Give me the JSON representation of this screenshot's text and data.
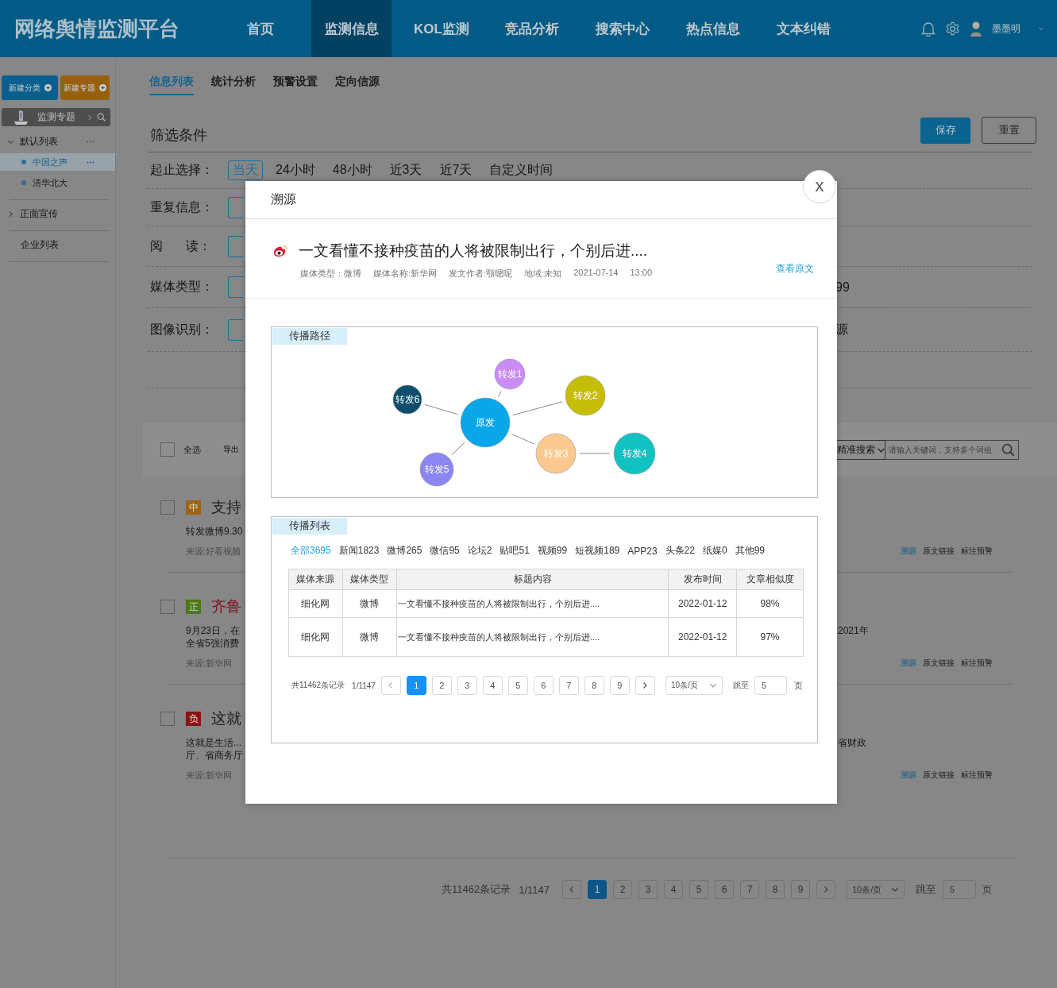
{
  "header": {
    "logo": "网络舆情监测平台",
    "nav": [
      {
        "label": "首页",
        "selected": false
      },
      {
        "label": "监测信息",
        "selected": true
      },
      {
        "label": "KOL监测",
        "selected": false
      },
      {
        "label": "竞品分析",
        "selected": false
      },
      {
        "label": "搜索中心",
        "selected": false
      },
      {
        "label": "热点信息",
        "selected": false
      },
      {
        "label": "文本纠错",
        "selected": false
      }
    ],
    "user": "墨墨明"
  },
  "sidebar": {
    "buttons": [
      {
        "label": "新建分类",
        "kind": "primary"
      },
      {
        "label": "新建专题",
        "kind": "warning"
      }
    ],
    "panel_title": "监测专题",
    "tree": [
      {
        "label": "默认列表",
        "kind": "folder",
        "expanded": true,
        "children": [
          {
            "label": "中国之声",
            "selected": true
          },
          {
            "label": "清华北大",
            "selected": false
          }
        ]
      },
      {
        "label": "正面宣传",
        "kind": "folder",
        "expanded": false
      },
      {
        "label": "企业列表",
        "kind": "item"
      }
    ]
  },
  "tabs": [
    {
      "label": "信息列表",
      "selected": true
    },
    {
      "label": "统计分析",
      "selected": false
    },
    {
      "label": "预警设置",
      "selected": false
    },
    {
      "label": "定向信源",
      "selected": false
    }
  ],
  "filter": {
    "title": "筛选条件",
    "buttons": [
      {
        "label": "保存",
        "kind": "primary"
      },
      {
        "label": "重置",
        "kind": "default"
      }
    ],
    "rows": [
      {
        "label": "起止选择：",
        "kind": "options",
        "options": [
          {
            "label": "当天",
            "selected": true
          },
          {
            "label": "24小时",
            "selected": false
          },
          {
            "label": "48小时",
            "selected": false
          },
          {
            "label": "近3天",
            "selected": false
          },
          {
            "label": "近7天",
            "selected": false
          },
          {
            "label": "自定义时间",
            "selected": false
          }
        ]
      },
      {
        "label": "重复信息：",
        "kind": "covered"
      },
      {
        "label": "阅 读：",
        "kind": "covered"
      },
      {
        "label": "媒体类型：",
        "kind": "covered",
        "tail": "99"
      },
      {
        "label": "图像识别：",
        "kind": "covered",
        "tail": "源"
      }
    ]
  },
  "toolbar": {
    "select_all": "全选",
    "checked": false,
    "export": "导出",
    "search_mode": "精准搜索",
    "search_placeholder": "请输入关键词，支持多个词组"
  },
  "articles": [
    {
      "checked": false,
      "tag": "中",
      "color": "#9c6416",
      "title": "支持",
      "highlighted": false,
      "lines": [
        {
          "left": "转发微博9.30"
        }
      ],
      "source": "来源:好看视频",
      "actions": [
        {
          "label": "溯源",
          "kind": "link"
        },
        {
          "label": "原文链接",
          "kind": "plain"
        },
        {
          "label": "标注预警",
          "kind": "plain"
        }
      ]
    },
    {
      "checked": false,
      "tag": "正",
      "color": "#4c7a14",
      "title": "齐鲁",
      "highlighted": true,
      "lines": [
        {
          "left": "9月23日，在",
          "right": "2021年"
        },
        {
          "left": "全省5强消费"
        }
      ],
      "source": "来源:新华网",
      "actions": [
        {
          "label": "溯源",
          "kind": "link"
        },
        {
          "label": "原文链接",
          "kind": "plain"
        },
        {
          "label": "标注预警",
          "kind": "plain"
        }
      ]
    },
    {
      "checked": false,
      "tag": "负",
      "color": "#8c1212",
      "title": "这就",
      "highlighted": false,
      "lines": [
        {
          "left": "这就是生活...",
          "right": "省财政"
        },
        {
          "left": "厅、省商务厅"
        }
      ],
      "source": "来源:新华网",
      "actions": [
        {
          "label": "溯源",
          "kind": "link"
        },
        {
          "label": "原文链接",
          "kind": "plain"
        },
        {
          "label": "标注预警",
          "kind": "plain"
        }
      ]
    }
  ],
  "pagination": {
    "total": "共11462条记录",
    "page_info": "1/1147",
    "pages": [
      {
        "label": "1",
        "selected": true
      },
      {
        "label": "2",
        "selected": false
      },
      {
        "label": "3",
        "selected": false
      },
      {
        "label": "4",
        "selected": false
      },
      {
        "label": "5",
        "selected": false
      },
      {
        "label": "6",
        "selected": false
      },
      {
        "label": "7",
        "selected": false
      },
      {
        "label": "8",
        "selected": false
      },
      {
        "label": "9",
        "selected": false
      }
    ],
    "page_size": "10条/页",
    "jump_label": "跳至",
    "jump_value": "5",
    "page_suffix": "页"
  },
  "modal": {
    "title": "溯源",
    "close": "x",
    "article": {
      "title": "一文看懂不接种疫苗的人将被限制出行，个别后进....",
      "meta": [
        "媒体类型：微博",
        "媒体名称:新华网",
        "发文作者:颚嗯呢",
        "地域:未知",
        "2021-07-14",
        "13:00"
      ],
      "link": "查看原文"
    },
    "path": {
      "title": "传播路径",
      "root": {
        "label": "原发",
        "color": "#0aa6ea",
        "children": [
          {
            "label": "转发1",
            "color": "#c98bf5"
          },
          {
            "label": "转发2",
            "color": "#c5bd06"
          },
          {
            "label": "转发3",
            "color": "#f9c98f",
            "children": [
              {
                "label": "转发4",
                "color": "#12c2c0"
              }
            ]
          },
          {
            "label": "转发5",
            "color": "#8c86f2"
          },
          {
            "label": "转发6",
            "color": "#0c4e6c"
          }
        ]
      }
    },
    "list": {
      "title": "传播列表",
      "filters": [
        {
          "label": "全部3695",
          "selected": true
        },
        {
          "label": "新闻1823",
          "selected": false
        },
        {
          "label": "微博265",
          "selected": false
        },
        {
          "label": "微信95",
          "selected": false
        },
        {
          "label": "论坛2",
          "selected": false
        },
        {
          "label": "贴吧51",
          "selected": false
        },
        {
          "label": "视频99",
          "selected": false
        },
        {
          "label": "短视频189",
          "selected": false
        },
        {
          "label": "APP23",
          "selected": false
        },
        {
          "label": "头条22",
          "selected": false
        },
        {
          "label": "纸媒0",
          "selected": false
        },
        {
          "label": "其他99",
          "selected": false
        }
      ],
      "columns": [
        "媒体来源",
        "媒体类型",
        "标题内容",
        "发布时间",
        "文章相似度"
      ],
      "rows": [
        [
          "细化网",
          "微博",
          "一文看懂不接种疫苗的人将被限制出行，个别后进....",
          "2022-01-12",
          "98%"
        ],
        [
          "细化网",
          "微博",
          "一文看懂不接种疫苗的人将被限制出行，个别后进....",
          "2022-01-12",
          "97%"
        ]
      ],
      "pagination": {
        "total": "共11462条记录",
        "page_info": "1/1147",
        "pages": [
          {
            "label": "1",
            "selected": true
          },
          {
            "label": "2",
            "selected": false
          },
          {
            "label": "3",
            "selected": false
          },
          {
            "label": "4",
            "selected": false
          },
          {
            "label": "5",
            "selected": false
          },
          {
            "label": "6",
            "selected": false
          },
          {
            "label": "7",
            "selected": false
          },
          {
            "label": "8",
            "selected": false
          },
          {
            "label": "9",
            "selected": false
          }
        ],
        "page_size": "10条/页",
        "jump_label": "跳至",
        "jump_value": "5",
        "page_suffix": "页"
      }
    }
  }
}
